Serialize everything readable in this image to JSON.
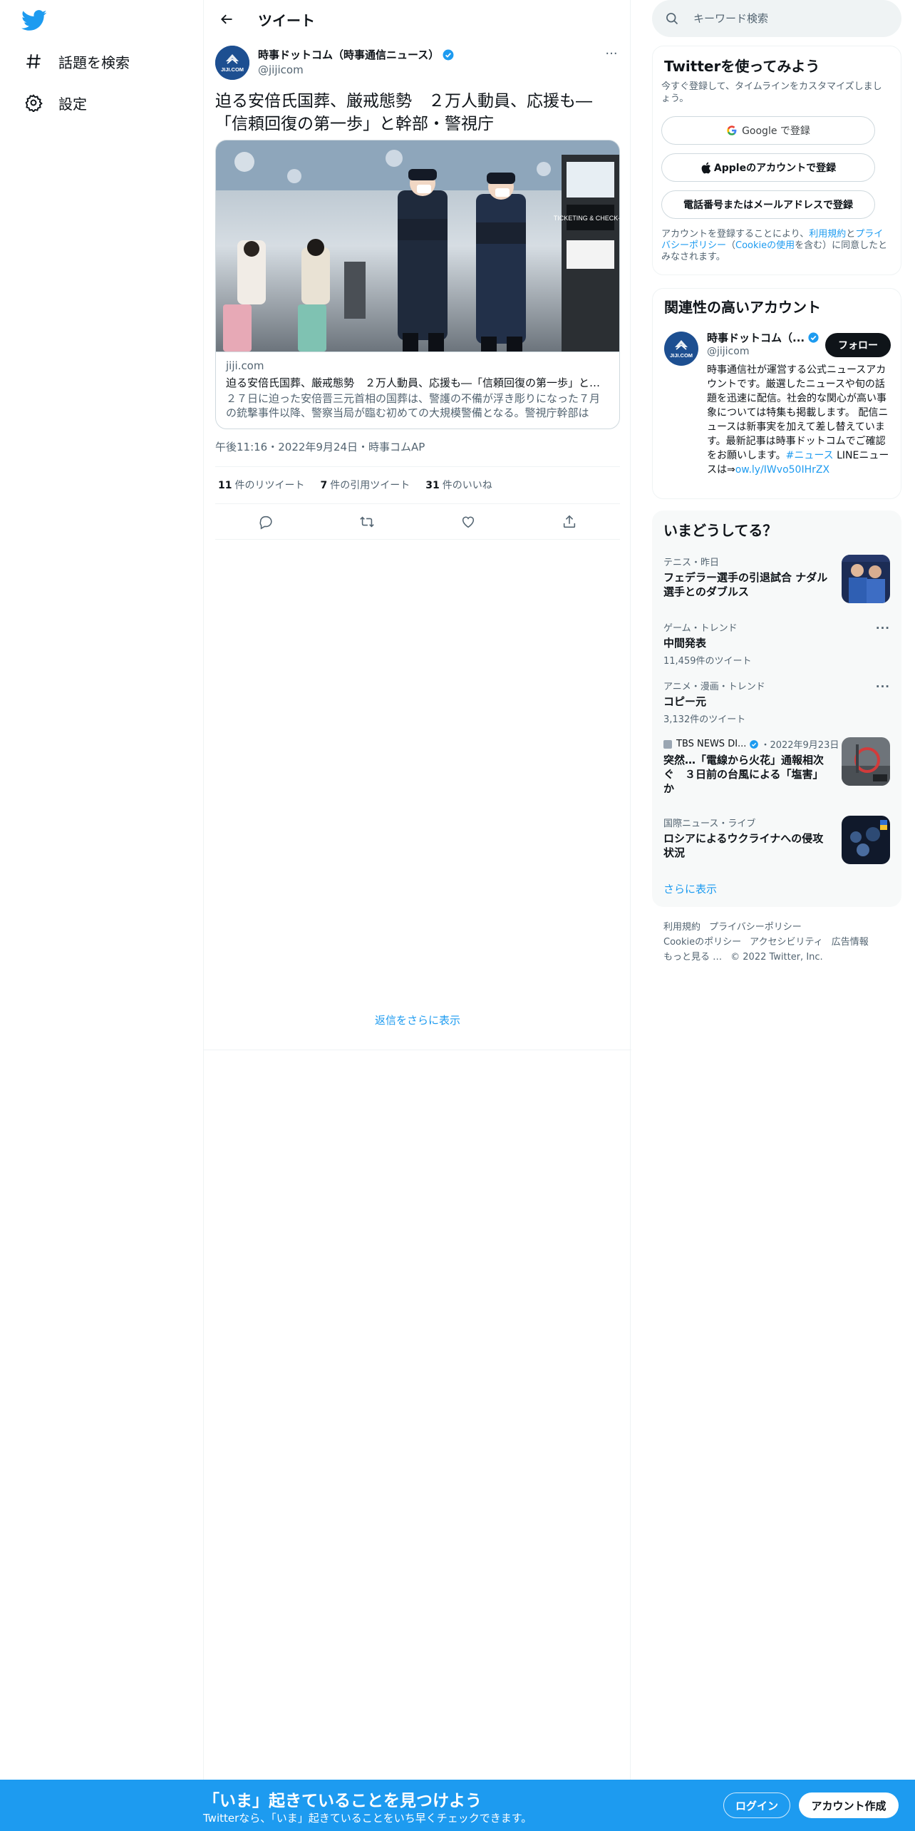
{
  "nav": {
    "items": [
      {
        "label": "話題を検索",
        "icon": "hashtag-icon"
      },
      {
        "label": "設定",
        "icon": "gear-icon"
      }
    ]
  },
  "header": {
    "title": "ツイート"
  },
  "tweet": {
    "author_name": "時事ドットコム（時事通信ニュース）",
    "author_handle": "@jijicom",
    "text": "迫る安倍氏国葬、厳戒態勢　２万人動員、応援も―「信頼回復の第一歩」と幹部・警視庁",
    "card": {
      "domain": "jiji.com",
      "title": "迫る安倍氏国葬、厳戒態勢　２万人動員、応援も―「信頼回復の第一歩」と幹部・警視庁",
      "description": "２７日に迫った安倍晋三元首相の国葬は、警護の不備が浮き彫りになった７月の銃撃事件以降、警察当局が臨む初めての大規模警備となる。警視庁幹部は「信頼回復の第一歩」",
      "image_sign": "TICKETING & CHECK-IN"
    },
    "meta": "午後11:16・2022年9月24日・時事コムAP",
    "stats": [
      {
        "count": "11",
        "label": "件のリツイート"
      },
      {
        "count": "7",
        "label": "件の引用ツイート"
      },
      {
        "count": "31",
        "label": "件のいいね"
      }
    ],
    "more_replies": "返信をさらに表示"
  },
  "sidebar": {
    "search_placeholder": "キーワード検索",
    "signup": {
      "title": "Twitterを使ってみよう",
      "subtitle": "今すぐ登録して、タイムラインをカスタマイズしましょう。",
      "google_btn": "Google で登録",
      "apple_btn": "Appleのアカウントで登録",
      "phone_btn": "電話番号またはメールアドレスで登録",
      "terms_prefix": "アカウントを登録することにより、",
      "terms_link": "利用規約",
      "terms_and": "と",
      "privacy_link": "プライバシーポリシー",
      "terms_paren_open": "（",
      "cookie_link": "Cookieの使用",
      "terms_suffix": "を含む）に同意したとみなされます。"
    },
    "relevant": {
      "title": "関連性の高いアカウント",
      "name": "時事ドットコム（...",
      "handle": "@jijicom",
      "follow_btn": "フォロー",
      "bio": "時事通信社が運営する公式ニュースアカウントです。厳選したニュースや旬の話題を迅速に配信。社会的な関心が高い事象については特集も掲載します。 配信ニュースは新事実を加えて差し替えています。最新記事は時事ドットコムでご確認をお願いします。",
      "bio_hashtag": "#ニュース",
      "bio_line": " LINEニュースは⇒",
      "bio_link": "ow.ly/IWvo50IHrZX"
    },
    "trends": {
      "title": "いまどうしてる？",
      "items": [
        {
          "context": "テニス・昨日",
          "title": "フェデラー選手の引退試合 ナダル選手とのダブルス"
        },
        {
          "context": "ゲーム・トレンド",
          "title": "中間発表",
          "count": "11,459件のツイート"
        },
        {
          "context": "アニメ・漫画・トレンド",
          "title": "コピー元",
          "count": "3,132件のツイート"
        },
        {
          "source": "TBS NEWS DI...",
          "date": "・2022年9月23日",
          "title": "突然…「電線から火花」通報相次ぐ　３日前の台風による「塩害」か"
        },
        {
          "context": "国際ニュース・ライブ",
          "title": "ロシアによるウクライナへの侵攻状況"
        }
      ],
      "show_more": "さらに表示"
    },
    "footer": {
      "links": [
        "利用規約",
        "プライバシーポリシー",
        "Cookieのポリシー",
        "アクセシビリティ",
        "広告情報",
        "もっと見る …"
      ],
      "copyright": "© 2022 Twitter, Inc."
    }
  },
  "bottom_bar": {
    "title": "「いま」起きていることを見つけよう",
    "subtitle": "Twitterなら、「いま」起きていることをいち早くチェックできます。",
    "login": "ログイン",
    "signup": "アカウント作成"
  },
  "colors": {
    "accent": "#1d9bf0",
    "text": "#0f1419",
    "secondary": "#536471",
    "border": "#eff3f4"
  }
}
